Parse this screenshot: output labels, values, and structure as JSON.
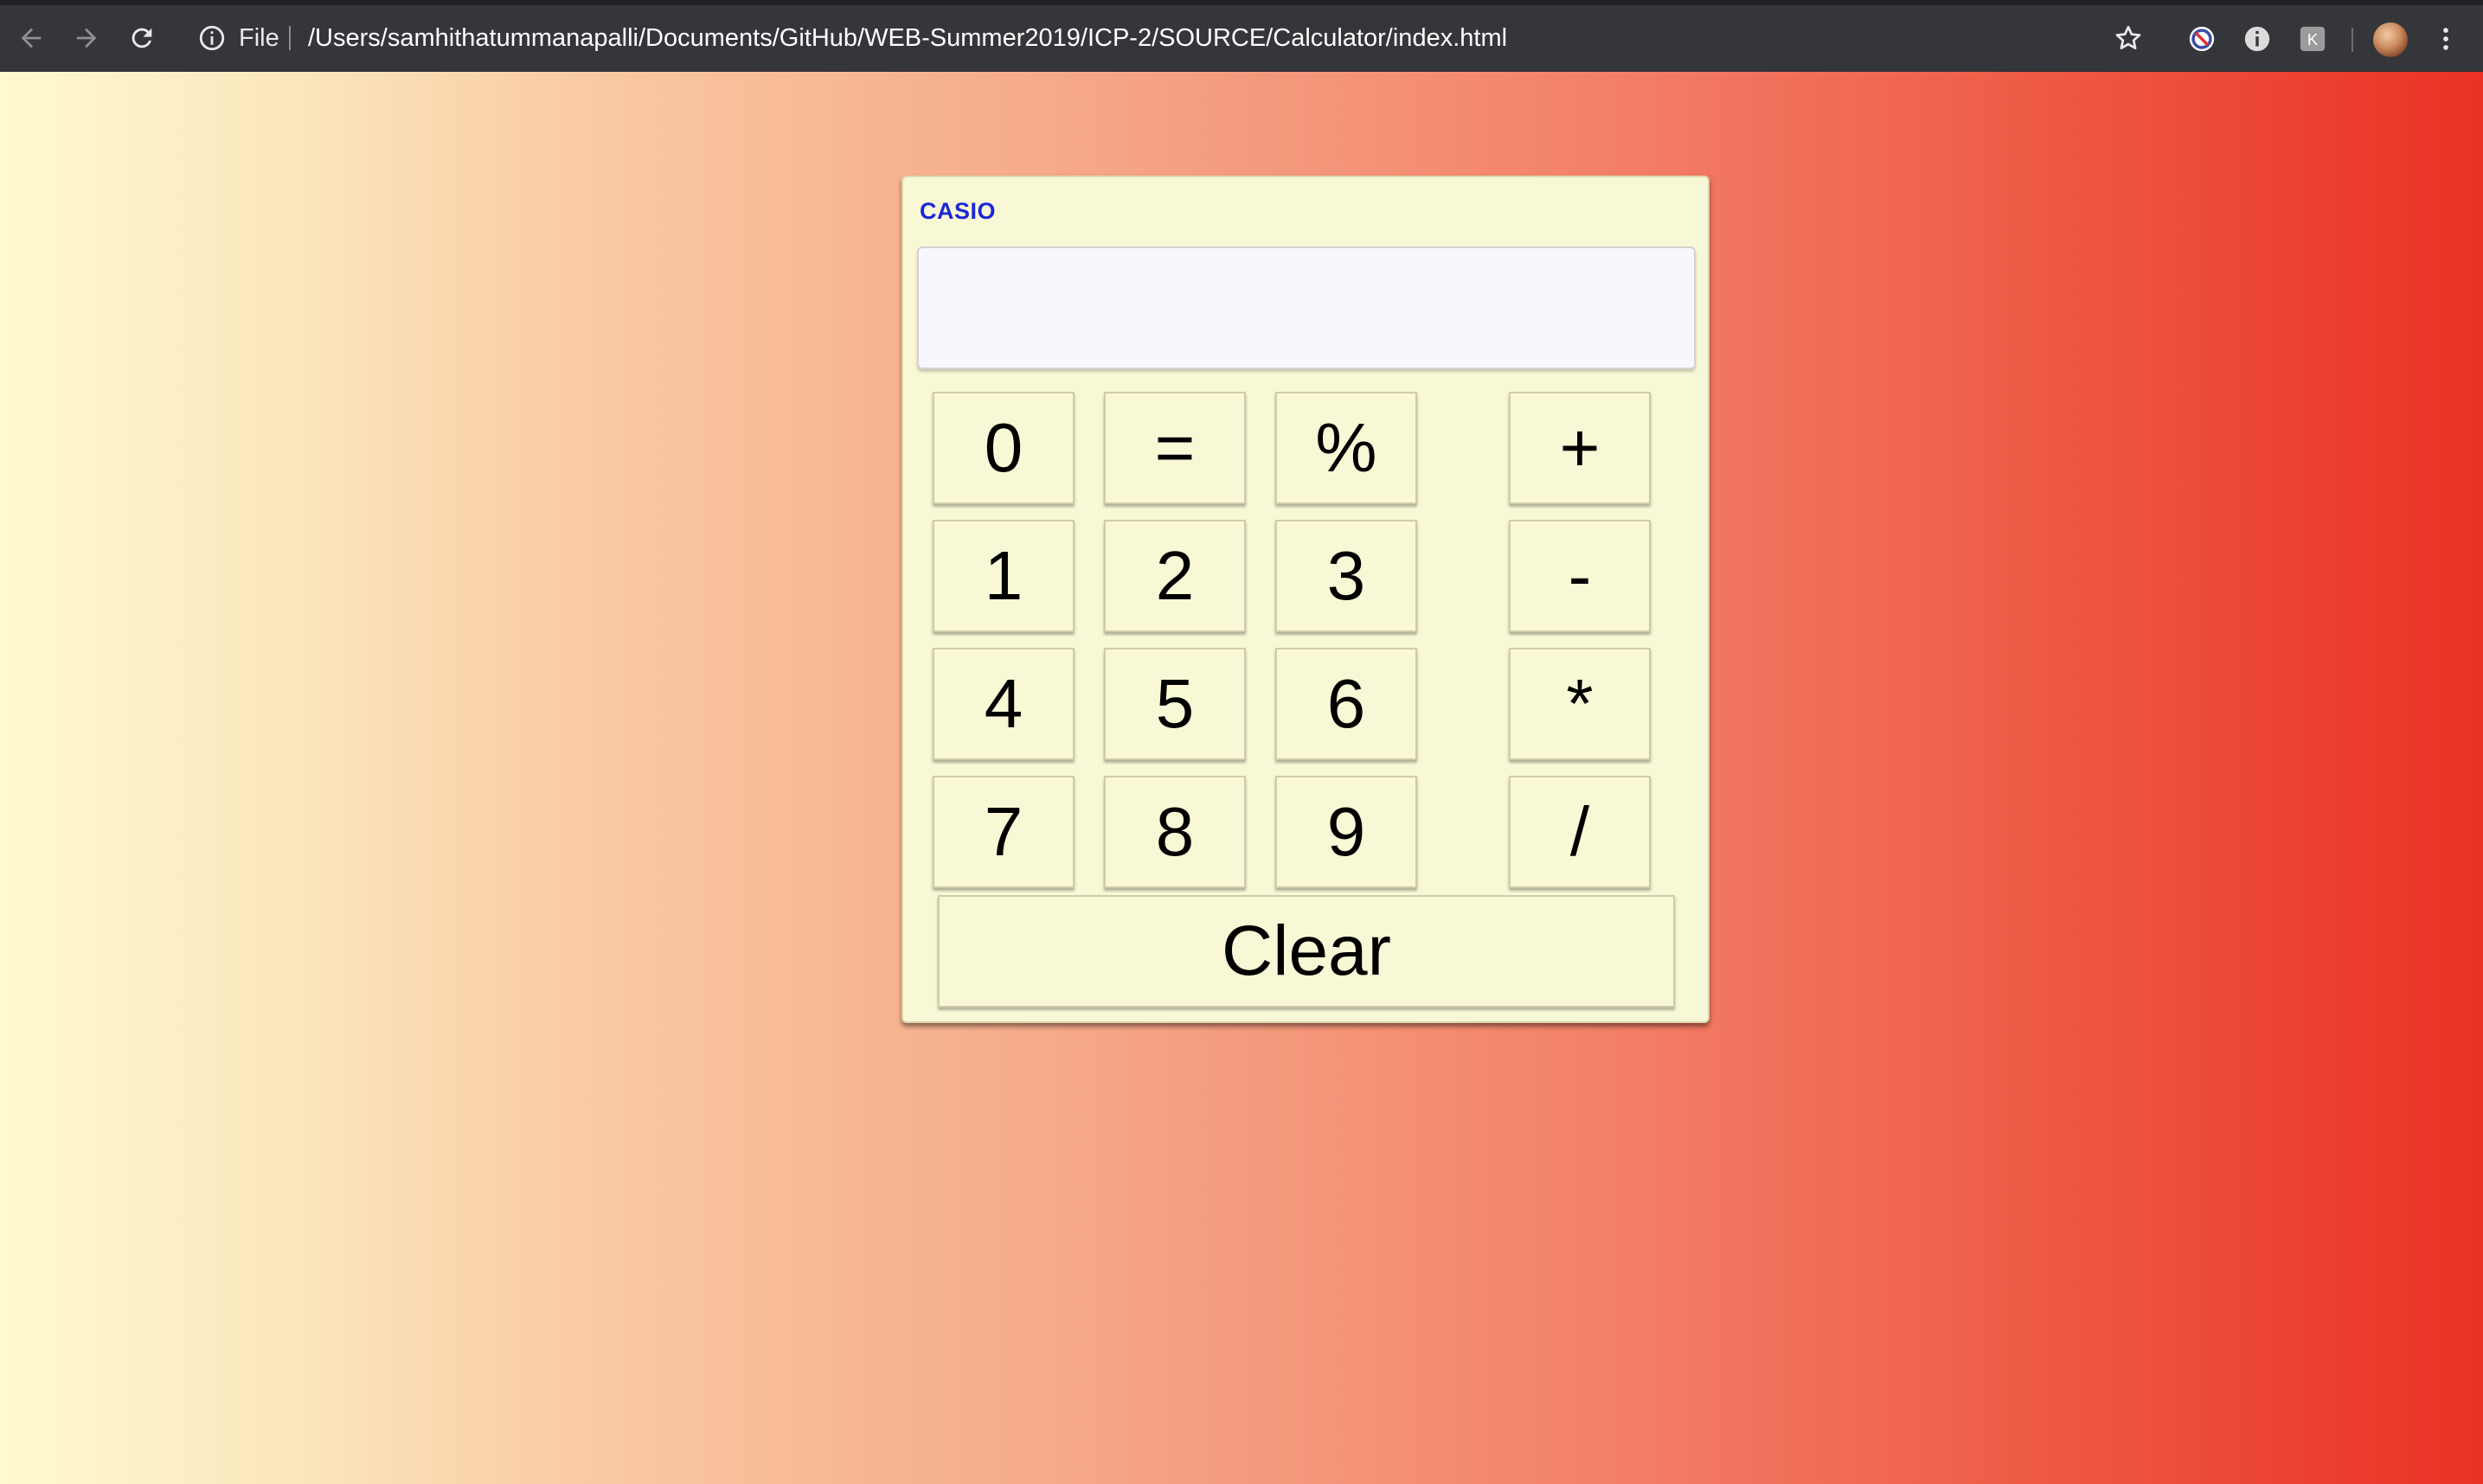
{
  "browser": {
    "scheme_label": "File",
    "url": "/Users/samhithatummanapalli/Documents/GitHub/WEB-Summer2019/ICP-2/SOURCE/Calculator/index.html"
  },
  "calculator": {
    "brand": "CASIO",
    "display_value": "",
    "keys": {
      "k0": "0",
      "equals": "=",
      "percent": "%",
      "plus": "+",
      "k1": "1",
      "k2": "2",
      "k3": "3",
      "minus": "-",
      "k4": "4",
      "k5": "5",
      "k6": "6",
      "multiply": "*",
      "k7": "7",
      "k8": "8",
      "k9": "9",
      "divide": "/",
      "clear": "Clear"
    }
  },
  "colors": {
    "brand_text": "#1b27d8",
    "calculator_body": "#f9f8d6",
    "gradient_start": "#fff9d0",
    "gradient_end": "#ea3124"
  }
}
